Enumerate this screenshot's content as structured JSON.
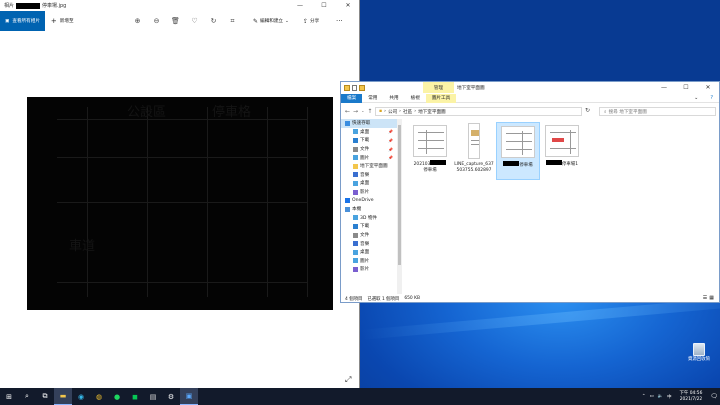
{
  "photos": {
    "title_prefix": "相片",
    "title_suffix": "停車場.jpg",
    "see_all": "查看所有相片",
    "add_to": "新增至",
    "edit_create": "編輯和建立",
    "share": "分享",
    "image_labels": {
      "a": "公設區",
      "b": "停車格",
      "c": "車道"
    }
  },
  "explorer": {
    "manage_tab": "管理",
    "window_name": "地下室平面圖",
    "ribbon": [
      "檔案",
      "常用",
      "共用",
      "檢視",
      "圖片工具"
    ],
    "path": [
      "公司",
      "社區",
      "地下室平面圖"
    ],
    "search_placeholder": "搜尋 地下室平面圖",
    "nav": [
      {
        "label": "快速存取",
        "top": true
      },
      {
        "label": "桌面",
        "pinned": true
      },
      {
        "label": "下載",
        "pinned": true
      },
      {
        "label": "文件",
        "pinned": true
      },
      {
        "label": "圖片",
        "pinned": true
      },
      {
        "label": "地下室平面圖"
      },
      {
        "label": "音樂"
      },
      {
        "label": "桌面"
      },
      {
        "label": "影片"
      },
      {
        "label": "OneDrive",
        "top": true
      },
      {
        "label": "本機",
        "top": true
      },
      {
        "label": "3D 物件"
      },
      {
        "label": "下載"
      },
      {
        "label": "文件"
      },
      {
        "label": "音樂"
      },
      {
        "label": "桌面"
      },
      {
        "label": "圖片"
      },
      {
        "label": "影片"
      }
    ],
    "files": [
      {
        "prefix": "202103",
        "suffix": "停車場"
      },
      {
        "prefix": "LINE_capture_637503755.602897",
        "suffix": ""
      },
      {
        "prefix": "",
        "suffix": "停車場"
      },
      {
        "prefix": "",
        "suffix": "停車場1"
      }
    ],
    "status": {
      "count": "4 個項目",
      "selected": "已選取 1 個項目",
      "size": "650 KB"
    }
  },
  "desktop": {
    "recycle_bin": "資源回收筒"
  },
  "taskbar": {
    "tray_lang": "中",
    "time": "下午 04:56",
    "date": "2021/7/22"
  }
}
